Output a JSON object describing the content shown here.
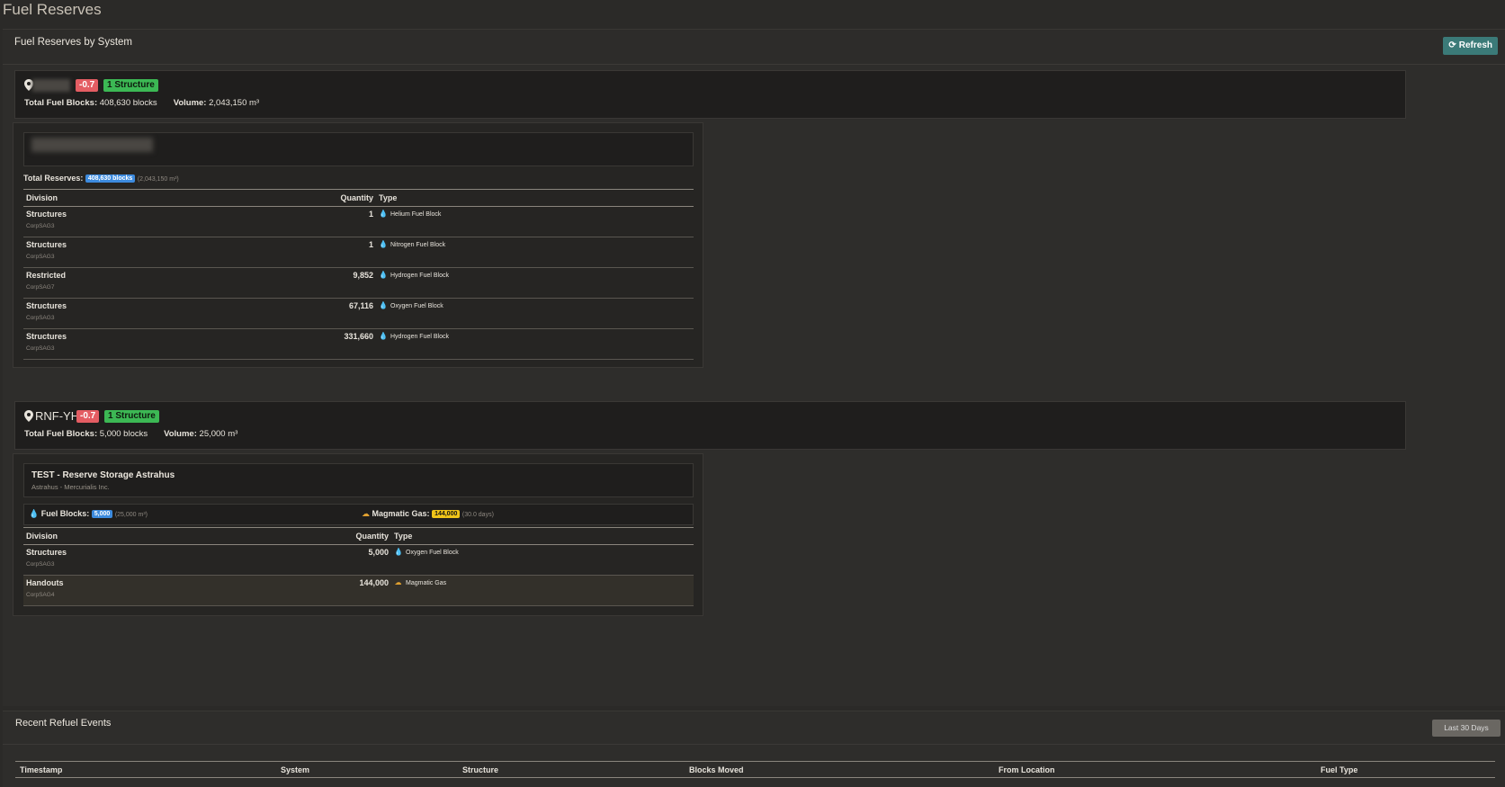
{
  "page": {
    "title": "Fuel Reserves"
  },
  "card": {
    "title": "Fuel Reserves by System",
    "refresh_label": "Refresh"
  },
  "systems": [
    {
      "name": "",
      "security": "-0.7",
      "structures_badge": "1 Structure",
      "total_label": "Total Fuel Blocks:",
      "total_value": "408,630 blocks",
      "volume_label": "Volume:",
      "volume_value": "2,043,150 m³",
      "structure": {
        "name": "",
        "reserves_label": "Total Reserves:",
        "reserves_blocks": "408,630 blocks",
        "reserves_volume": "(2,043,150 m³)",
        "columns": [
          "Division",
          "Quantity",
          "Type"
        ],
        "rows": [
          {
            "division": "Structures",
            "hangar": "CorpSAG3",
            "quantity": "1",
            "type": "Helium Fuel Block",
            "icon": "drop-green-icon"
          },
          {
            "division": "Structures",
            "hangar": "CorpSAG3",
            "quantity": "1",
            "type": "Nitrogen Fuel Block",
            "icon": "drop-blue-icon"
          },
          {
            "division": "Restricted",
            "hangar": "CorpSAG7",
            "quantity": "9,852",
            "type": "Hydrogen Fuel Block",
            "icon": "drop-green-icon"
          },
          {
            "division": "Structures",
            "hangar": "CorpSAG3",
            "quantity": "67,116",
            "type": "Oxygen Fuel Block",
            "icon": "drop-red-icon"
          },
          {
            "division": "Structures",
            "hangar": "CorpSAG3",
            "quantity": "331,660",
            "type": "Hydrogen Fuel Block",
            "icon": "drop-green-icon"
          }
        ]
      }
    },
    {
      "name": "RNF-YH",
      "security": "-0.7",
      "structures_badge": "1 Structure",
      "total_label": "Total Fuel Blocks:",
      "total_value": "5,000 blocks",
      "volume_label": "Volume:",
      "volume_value": "25,000 m³",
      "structure": {
        "name": "TEST - Reserve Storage Astrahus",
        "subtitle": "Astrahus - Mercurialis Inc.",
        "fuel_label": "Fuel Blocks:",
        "fuel_blocks": "5,000",
        "fuel_volume": "(25,000 m³)",
        "gas_label": "Magmatic Gas:",
        "gas_amount": "144,000",
        "gas_days": "(30.0 days)",
        "columns": [
          "Division",
          "Quantity",
          "Type"
        ],
        "rows": [
          {
            "division": "Structures",
            "hangar": "CorpSAG3",
            "quantity": "5,000",
            "type": "Oxygen Fuel Block",
            "icon": "drop-red-icon"
          },
          {
            "division": "Handouts",
            "hangar": "CorpSAG4",
            "quantity": "144,000",
            "type": "Magmatic Gas",
            "icon": "gas-icon"
          }
        ]
      }
    }
  ],
  "refuel": {
    "title": "Recent Refuel Events",
    "range_label": "Last 30 Days",
    "columns": [
      "Timestamp",
      "System",
      "Structure",
      "Blocks Moved",
      "From Location",
      "Fuel Type"
    ]
  },
  "colors": {
    "background": "#2b2a28",
    "security_badge": "#e45d63",
    "structure_badge": "#3cb854",
    "refresh_button": "#3b7a78",
    "blue_pill": "#3d8bde",
    "yellow_pill": "#f0c419"
  }
}
